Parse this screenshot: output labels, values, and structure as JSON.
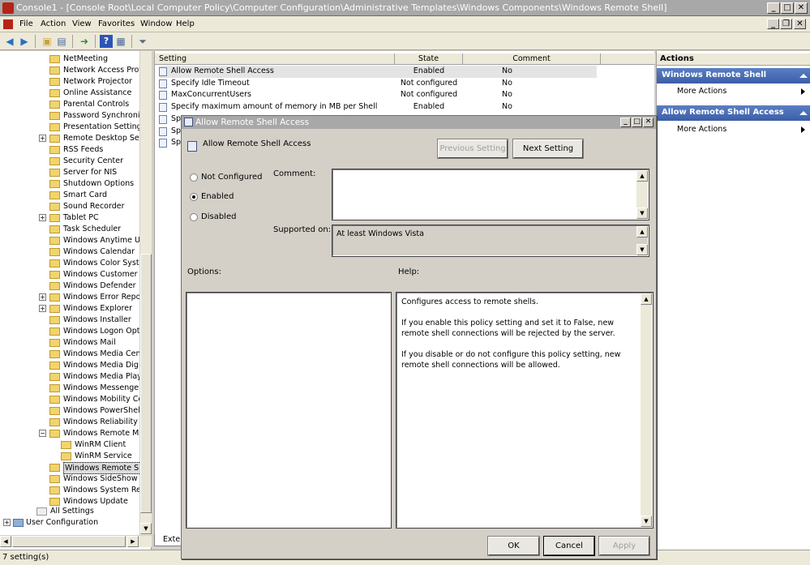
{
  "window": {
    "title": "Console1 - [Console Root\\Local Computer Policy\\Computer Configuration\\Administrative Templates\\Windows Components\\Windows Remote Shell]",
    "minimize": "_",
    "maximize": "□",
    "close": "✕"
  },
  "menu": [
    "File",
    "Action",
    "View",
    "Favorites",
    "Window",
    "Help"
  ],
  "mdi": {
    "minimize": "_",
    "restore": "❐",
    "close": "✕"
  },
  "toolbar": {
    "icons": [
      "back-icon",
      "forward-icon",
      "up-folder-icon",
      "show-hide-tree-icon",
      "export-list-icon",
      "help-icon",
      "properties-icon",
      "filter-icon"
    ]
  },
  "tree": {
    "items": [
      {
        "label": "NetMeeting",
        "expander": ""
      },
      {
        "label": "Network Access Protect",
        "expander": ""
      },
      {
        "label": "Network Projector",
        "expander": ""
      },
      {
        "label": "Online Assistance",
        "expander": ""
      },
      {
        "label": "Parental Controls",
        "expander": ""
      },
      {
        "label": "Password Synchronizati",
        "expander": ""
      },
      {
        "label": "Presentation Settings",
        "expander": ""
      },
      {
        "label": "Remote Desktop Servic",
        "expander": "+"
      },
      {
        "label": "RSS Feeds",
        "expander": ""
      },
      {
        "label": "Security Center",
        "expander": ""
      },
      {
        "label": "Server for NIS",
        "expander": ""
      },
      {
        "label": "Shutdown Options",
        "expander": ""
      },
      {
        "label": "Smart Card",
        "expander": ""
      },
      {
        "label": "Sound Recorder",
        "expander": ""
      },
      {
        "label": "Tablet PC",
        "expander": "+"
      },
      {
        "label": "Task Scheduler",
        "expander": ""
      },
      {
        "label": "Windows Anytime Upgr",
        "expander": ""
      },
      {
        "label": "Windows Calendar",
        "expander": ""
      },
      {
        "label": "Windows Color System",
        "expander": ""
      },
      {
        "label": "Windows Customer Exp",
        "expander": ""
      },
      {
        "label": "Windows Defender",
        "expander": ""
      },
      {
        "label": "Windows Error Reportin",
        "expander": "+"
      },
      {
        "label": "Windows Explorer",
        "expander": "+"
      },
      {
        "label": "Windows Installer",
        "expander": ""
      },
      {
        "label": "Windows Logon Option",
        "expander": ""
      },
      {
        "label": "Windows Mail",
        "expander": ""
      },
      {
        "label": "Windows Media Center",
        "expander": ""
      },
      {
        "label": "Windows Media Digital F",
        "expander": ""
      },
      {
        "label": "Windows Media Player",
        "expander": ""
      },
      {
        "label": "Windows Messenger",
        "expander": ""
      },
      {
        "label": "Windows Mobility Cente",
        "expander": ""
      },
      {
        "label": "Windows PowerShell",
        "expander": ""
      },
      {
        "label": "Windows Reliability Ana",
        "expander": ""
      },
      {
        "label": "Windows Remote Mana",
        "expander": "−"
      },
      {
        "label": "WinRM Client",
        "expander": "",
        "child": true
      },
      {
        "label": "WinRM Service",
        "expander": "",
        "child": true
      },
      {
        "label": "Windows Remote Shell",
        "expander": "",
        "selected": true
      },
      {
        "label": "Windows SideShow",
        "expander": ""
      },
      {
        "label": "Windows System Resou",
        "expander": ""
      },
      {
        "label": "Windows Update",
        "expander": ""
      }
    ],
    "all_settings": "All Settings",
    "user_configuration": "User Configuration",
    "user_expander": "+"
  },
  "list": {
    "headers": {
      "setting": "Setting",
      "state": "State",
      "comment": "Comment"
    },
    "rows": [
      {
        "setting": "Allow Remote Shell Access",
        "state": "Enabled",
        "comment": "No"
      },
      {
        "setting": "Specify Idle Timeout",
        "state": "Not configured",
        "comment": "No"
      },
      {
        "setting": "MaxConcurrentUsers",
        "state": "Not configured",
        "comment": "No"
      },
      {
        "setting": "Specify maximum amount of memory in MB per Shell",
        "state": "Enabled",
        "comment": "No"
      },
      {
        "setting": "Spe",
        "state": "",
        "comment": ""
      },
      {
        "setting": "Spe",
        "state": "",
        "comment": ""
      },
      {
        "setting": "Spe",
        "state": "",
        "comment": ""
      }
    ],
    "tab_label": "Exten"
  },
  "actions": {
    "header": "Actions",
    "sections": [
      {
        "title": "Windows Remote Shell",
        "item": "More Actions"
      },
      {
        "title": "Allow Remote Shell Access",
        "item": "More Actions"
      }
    ]
  },
  "status": "7 setting(s)",
  "dialog": {
    "title": "Allow Remote Shell Access",
    "policy_name": "Allow Remote Shell Access",
    "prev_button": "Previous Setting",
    "next_button": "Next Setting",
    "radios": [
      "Not Configured",
      "Enabled",
      "Disabled"
    ],
    "selected_radio": "Enabled",
    "comment_label": "Comment:",
    "comment_value": "",
    "supported_label": "Supported on:",
    "supported_value": "At least Windows Vista",
    "options_label": "Options:",
    "help_label": "Help:",
    "help_paragraphs": [
      "Configures access to remote shells.",
      "If you enable this policy setting and set it to False, new remote shell connections will be rejected by the server.",
      "If you disable or do not configure this policy setting, new remote shell connections will be allowed."
    ],
    "ok": "OK",
    "cancel": "Cancel",
    "apply": "Apply"
  }
}
